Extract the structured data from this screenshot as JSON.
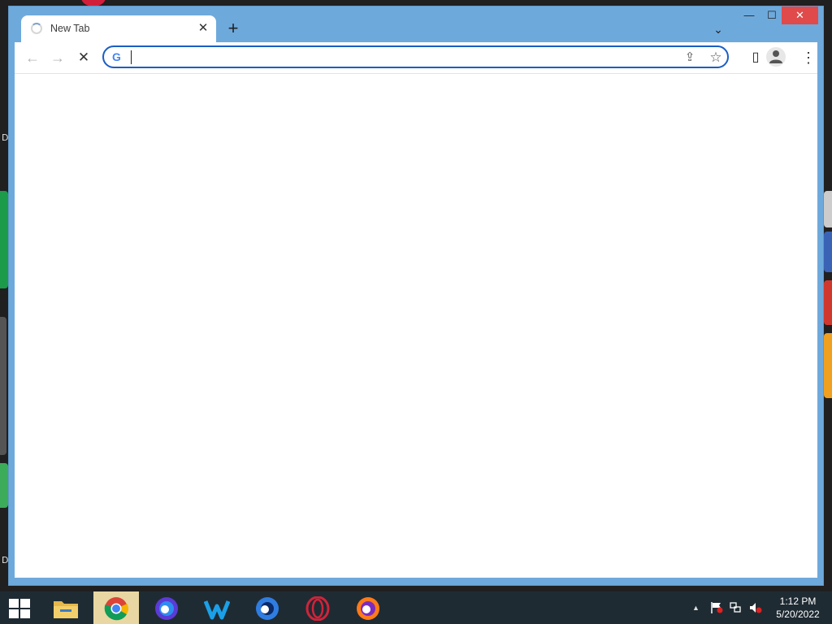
{
  "desktop": {
    "left_letters": [
      "D",
      "D"
    ]
  },
  "browser": {
    "tab": {
      "title": "New Tab",
      "close_glyph": "✕"
    },
    "new_tab_glyph": "+",
    "tab_search_glyph": "⌄",
    "window_controls": {
      "minimize": "—",
      "maximize": "☐",
      "close": "✕"
    },
    "toolbar": {
      "back_glyph": "←",
      "forward_glyph": "→",
      "stop_glyph": "✕",
      "omnibox": {
        "value": "",
        "placeholder": "",
        "g_label": "G"
      },
      "share_glyph": "⇪",
      "bookmark_glyph": "☆",
      "side_panel_glyph": "▯",
      "menu_glyph": "⋮"
    }
  },
  "taskbar": {
    "start_icon": "windows-logo",
    "apps": [
      {
        "name": "file-explorer",
        "active": false
      },
      {
        "name": "chrome",
        "active": true
      },
      {
        "name": "firefox-dev",
        "active": false
      },
      {
        "name": "waterfox",
        "active": false
      },
      {
        "name": "firefox-nightly",
        "active": false
      },
      {
        "name": "opera",
        "active": false
      },
      {
        "name": "firefox",
        "active": false
      }
    ],
    "tray": {
      "chevron": "▲"
    },
    "clock": {
      "time": "1:12 PM",
      "date": "5/20/2022"
    }
  }
}
